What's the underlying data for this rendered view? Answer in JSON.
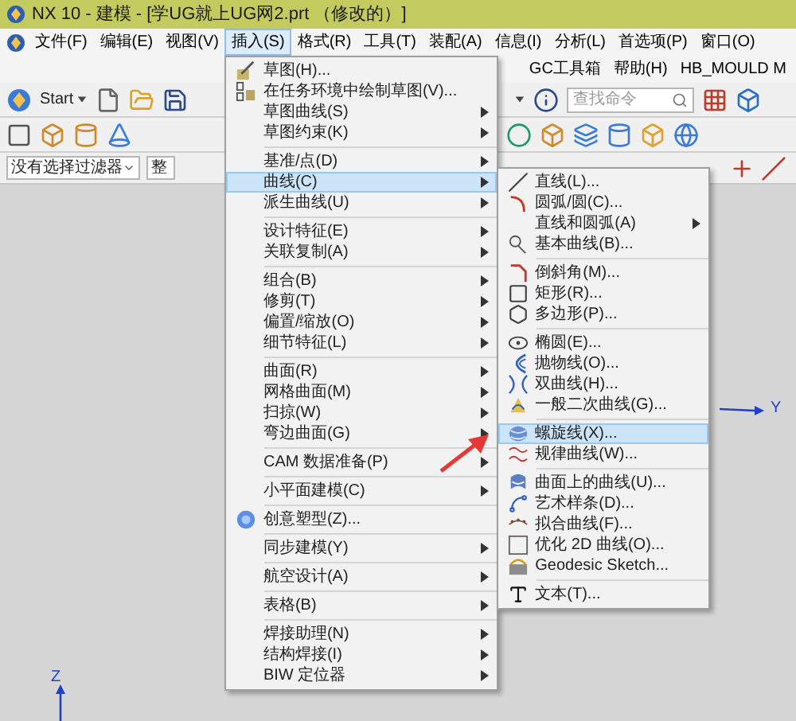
{
  "window": {
    "title": "NX 10 - 建模 - [学UG就上UG网2.prt （修改的）]"
  },
  "menubar": [
    {
      "label": "文件(F)",
      "selected": false
    },
    {
      "label": "编辑(E)",
      "selected": false
    },
    {
      "label": "视图(V)",
      "selected": false
    },
    {
      "label": "插入(S)",
      "selected": true
    },
    {
      "label": "格式(R)",
      "selected": false
    },
    {
      "label": "工具(T)",
      "selected": false
    },
    {
      "label": "装配(A)",
      "selected": false
    },
    {
      "label": "信息(I)",
      "selected": false
    },
    {
      "label": "分析(L)",
      "selected": false
    },
    {
      "label": "首选项(P)",
      "selected": false
    },
    {
      "label": "窗口(O)",
      "selected": false
    },
    {
      "label": "GC工具箱",
      "selected": false
    },
    {
      "label": "帮助(H)",
      "selected": false
    },
    {
      "label": "HB_MOULD M",
      "selected": false
    }
  ],
  "toolbar": {
    "start": "Start",
    "search": {
      "placeholder": "查找命令"
    }
  },
  "filter_bar": {
    "filter": "没有选择过滤器",
    "scope": "整"
  },
  "insert_menu": [
    {
      "kind": "item",
      "label": "草图(H)...",
      "submenu": false,
      "selected": false
    },
    {
      "kind": "item",
      "label": "在任务环境中绘制草图(V)...",
      "submenu": false,
      "selected": false
    },
    {
      "kind": "item",
      "label": "草图曲线(S)",
      "submenu": true,
      "selected": false
    },
    {
      "kind": "item",
      "label": "草图约束(K)",
      "submenu": true,
      "selected": false
    },
    {
      "kind": "separator"
    },
    {
      "kind": "item",
      "label": "基准/点(D)",
      "submenu": true,
      "selected": false
    },
    {
      "kind": "item",
      "label": "曲线(C)",
      "submenu": true,
      "selected": true
    },
    {
      "kind": "item",
      "label": "派生曲线(U)",
      "submenu": true,
      "selected": false
    },
    {
      "kind": "separator"
    },
    {
      "kind": "item",
      "label": "设计特征(E)",
      "submenu": true,
      "selected": false
    },
    {
      "kind": "item",
      "label": "关联复制(A)",
      "submenu": true,
      "selected": false
    },
    {
      "kind": "separator"
    },
    {
      "kind": "item",
      "label": "组合(B)",
      "submenu": true,
      "selected": false
    },
    {
      "kind": "item",
      "label": "修剪(T)",
      "submenu": true,
      "selected": false
    },
    {
      "kind": "item",
      "label": "偏置/缩放(O)",
      "submenu": true,
      "selected": false
    },
    {
      "kind": "item",
      "label": "细节特征(L)",
      "submenu": true,
      "selected": false
    },
    {
      "kind": "separator"
    },
    {
      "kind": "item",
      "label": "曲面(R)",
      "submenu": true,
      "selected": false
    },
    {
      "kind": "item",
      "label": "网格曲面(M)",
      "submenu": true,
      "selected": false
    },
    {
      "kind": "item",
      "label": "扫掠(W)",
      "submenu": true,
      "selected": false
    },
    {
      "kind": "item",
      "label": "弯边曲面(G)",
      "submenu": true,
      "selected": false
    },
    {
      "kind": "separator"
    },
    {
      "kind": "item",
      "label": "CAM 数据准备(P)",
      "submenu": true,
      "selected": false
    },
    {
      "kind": "separator"
    },
    {
      "kind": "item",
      "label": "小平面建模(C)",
      "submenu": true,
      "selected": false
    },
    {
      "kind": "separator"
    },
    {
      "kind": "item",
      "label": "创意塑型(Z)...",
      "submenu": false,
      "selected": false
    },
    {
      "kind": "separator"
    },
    {
      "kind": "item",
      "label": "同步建模(Y)",
      "submenu": true,
      "selected": false
    },
    {
      "kind": "separator"
    },
    {
      "kind": "item",
      "label": "航空设计(A)",
      "submenu": true,
      "selected": false
    },
    {
      "kind": "separator"
    },
    {
      "kind": "item",
      "label": "表格(B)",
      "submenu": true,
      "selected": false
    },
    {
      "kind": "separator"
    },
    {
      "kind": "item",
      "label": "焊接助理(N)",
      "submenu": true,
      "selected": false
    },
    {
      "kind": "item",
      "label": "结构焊接(I)",
      "submenu": true,
      "selected": false
    },
    {
      "kind": "item",
      "label": "BIW 定位器",
      "submenu": true,
      "selected": false
    }
  ],
  "curve_menu": [
    {
      "kind": "item",
      "label": "直线(L)...",
      "submenu": false,
      "selected": false
    },
    {
      "kind": "item",
      "label": "圆弧/圆(C)...",
      "submenu": false,
      "selected": false
    },
    {
      "kind": "item",
      "label": "直线和圆弧(A)",
      "submenu": true,
      "selected": false
    },
    {
      "kind": "item",
      "label": "基本曲线(B)...",
      "submenu": false,
      "selected": false
    },
    {
      "kind": "separator"
    },
    {
      "kind": "item",
      "label": "倒斜角(M)...",
      "submenu": false,
      "selected": false
    },
    {
      "kind": "item",
      "label": "矩形(R)...",
      "submenu": false,
      "selected": false
    },
    {
      "kind": "item",
      "label": "多边形(P)...",
      "submenu": false,
      "selected": false
    },
    {
      "kind": "separator"
    },
    {
      "kind": "item",
      "label": "椭圆(E)...",
      "submenu": false,
      "selected": false
    },
    {
      "kind": "item",
      "label": "抛物线(O)...",
      "submenu": false,
      "selected": false
    },
    {
      "kind": "item",
      "label": "双曲线(H)...",
      "submenu": false,
      "selected": false
    },
    {
      "kind": "item",
      "label": "一般二次曲线(G)...",
      "submenu": false,
      "selected": false
    },
    {
      "kind": "separator"
    },
    {
      "kind": "item",
      "label": "螺旋线(X)...",
      "submenu": false,
      "selected": true
    },
    {
      "kind": "item",
      "label": "规律曲线(W)...",
      "submenu": false,
      "selected": false
    },
    {
      "kind": "separator"
    },
    {
      "kind": "item",
      "label": "曲面上的曲线(U)...",
      "submenu": false,
      "selected": false
    },
    {
      "kind": "item",
      "label": "艺术样条(D)...",
      "submenu": false,
      "selected": false
    },
    {
      "kind": "item",
      "label": "拟合曲线(F)...",
      "submenu": false,
      "selected": false
    },
    {
      "kind": "item",
      "label": "优化 2D 曲线(O)...",
      "submenu": false,
      "selected": false
    },
    {
      "kind": "item",
      "label": "Geodesic Sketch...",
      "submenu": false,
      "selected": false
    },
    {
      "kind": "separator"
    },
    {
      "kind": "item",
      "label": "文本(T)...",
      "submenu": false,
      "selected": false
    }
  ],
  "canvas": {
    "axis_labels": [
      {
        "label": "Y"
      },
      {
        "label": "Z"
      }
    ]
  }
}
